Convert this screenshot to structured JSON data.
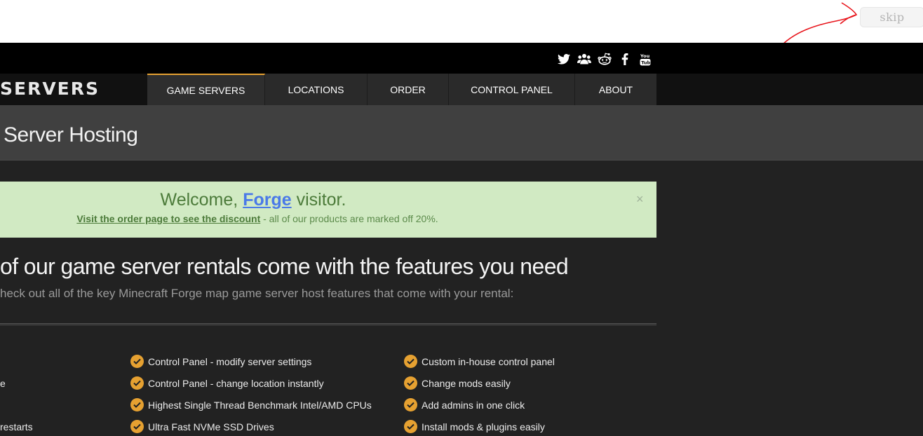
{
  "skip_label": "skip",
  "social": [
    "twitter-icon",
    "community-icon",
    "reddit-icon",
    "facebook-icon",
    "youtube-icon"
  ],
  "logo_text": "SERVERS",
  "nav": [
    {
      "label": "GAME SERVERS",
      "active": true
    },
    {
      "label": "LOCATIONS"
    },
    {
      "label": "ORDER"
    },
    {
      "label": "CONTROL PANEL"
    },
    {
      "label": "ABOUT"
    }
  ],
  "page_title": "Server Hosting",
  "welcome": {
    "prefix": "Welcome, ",
    "link": "Forge",
    "suffix": " visitor.",
    "discount_link": "Visit the order page to see the discount",
    "discount_rest": " - all of our products are marked off 20%.",
    "close": "×"
  },
  "features": {
    "title": "of our game server rentals come with the features you need",
    "subtitle": "heck out all of the key Minecraft Forge map game server host features that come with your rental:",
    "col0": [
      "",
      "e",
      "",
      "restarts"
    ],
    "col1": [
      "Control Panel - modify server settings",
      "Control Panel - change location instantly",
      "Highest Single Thread Benchmark Intel/AMD CPUs",
      "Ultra Fast NVMe SSD Drives"
    ],
    "col2": [
      "Custom in-house control panel",
      "Change mods easily",
      "Add admins in one click",
      "Install mods & plugins easily"
    ]
  }
}
